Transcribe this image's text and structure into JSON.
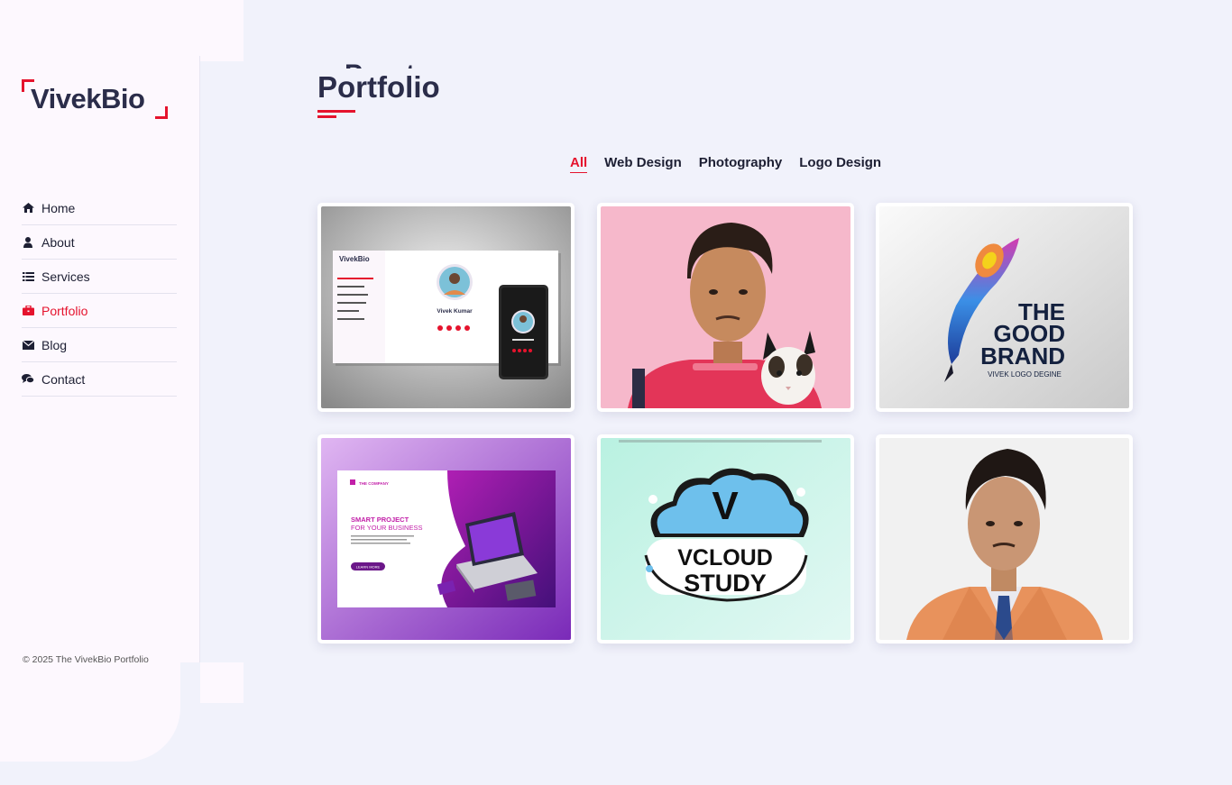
{
  "brand": {
    "name": "VivekBio",
    "accent_color": "#e5132d",
    "text_color": "#2b2d4a"
  },
  "nav": [
    {
      "label": "Home",
      "icon": "home-icon",
      "active": false
    },
    {
      "label": "About",
      "icon": "user-icon",
      "active": false
    },
    {
      "label": "Services",
      "icon": "list-icon",
      "active": false
    },
    {
      "label": "Portfolio",
      "icon": "briefcase-icon",
      "active": true
    },
    {
      "label": "Blog",
      "icon": "envelope-icon",
      "active": false
    },
    {
      "label": "Contact",
      "icon": "chat-icon",
      "active": false
    }
  ],
  "footer": {
    "text": "© 2025 The VivekBio Portfolio"
  },
  "page": {
    "title": "Portfolio"
  },
  "filters": [
    {
      "label": "All",
      "active": true
    },
    {
      "label": "Web Design",
      "active": false
    },
    {
      "label": "Photography",
      "active": false
    },
    {
      "label": "Logo Design",
      "active": false
    }
  ],
  "portfolio": {
    "item1": {
      "site_logo": "VivekBio",
      "profile_name": "Vivek Kumar",
      "nav": [
        "Home",
        "About",
        "Services",
        "Portfolio",
        "Blog",
        "Contact"
      ]
    },
    "item3": {
      "line1": "THE",
      "line2": "GOOD",
      "line3": "BRAND",
      "tagline": "VIVEK LOGO DEGINE"
    },
    "item4": {
      "company": "THE COMPANY",
      "headline1": "SMART PROJECT",
      "headline2": "FOR YOUR BUSINESS",
      "button": "LEARN MORE"
    },
    "item5": {
      "letter": "V",
      "line1": "VCLOUD",
      "line2": "STUDY"
    }
  }
}
